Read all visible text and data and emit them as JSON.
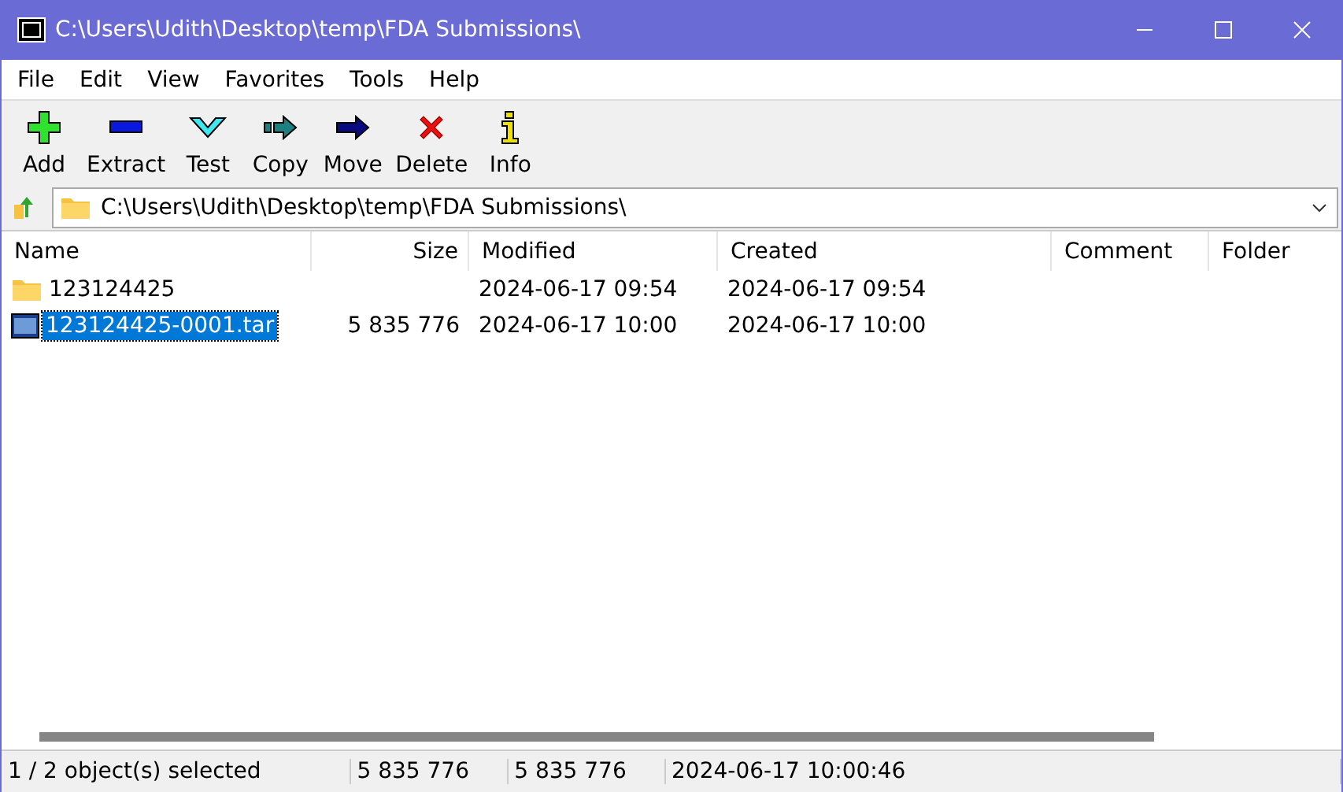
{
  "window": {
    "title": "C:\\Users\\Udith\\Desktop\\temp\\FDA Submissions\\"
  },
  "menu": [
    "File",
    "Edit",
    "View",
    "Favorites",
    "Tools",
    "Help"
  ],
  "toolbar": [
    {
      "kind": "add",
      "label": "Add"
    },
    {
      "kind": "extract",
      "label": "Extract"
    },
    {
      "kind": "test",
      "label": "Test"
    },
    {
      "kind": "copy",
      "label": "Copy"
    },
    {
      "kind": "move",
      "label": "Move"
    },
    {
      "kind": "delete",
      "label": "Delete"
    },
    {
      "kind": "info",
      "label": "Info"
    }
  ],
  "address": {
    "value": "C:\\Users\\Udith\\Desktop\\temp\\FDA Submissions\\"
  },
  "table": {
    "columns": [
      "Name",
      "Size",
      "Modified",
      "Created",
      "Comment",
      "Folder"
    ],
    "rows": [
      {
        "kind": "folder",
        "selected": false,
        "cells": [
          "123124425",
          "",
          "2024-06-17 09:54",
          "2024-06-17 09:54"
        ]
      },
      {
        "kind": "archive",
        "selected": true,
        "cells": [
          "123124425-0001.tar",
          "5 835 776",
          "2024-06-17 10:00",
          "2024-06-17 10:00"
        ]
      }
    ]
  },
  "status_bar": [
    "1 / 2 object(s) selected",
    "5 835 776",
    "5 835 776",
    "2024-06-17 10:00:46"
  ]
}
